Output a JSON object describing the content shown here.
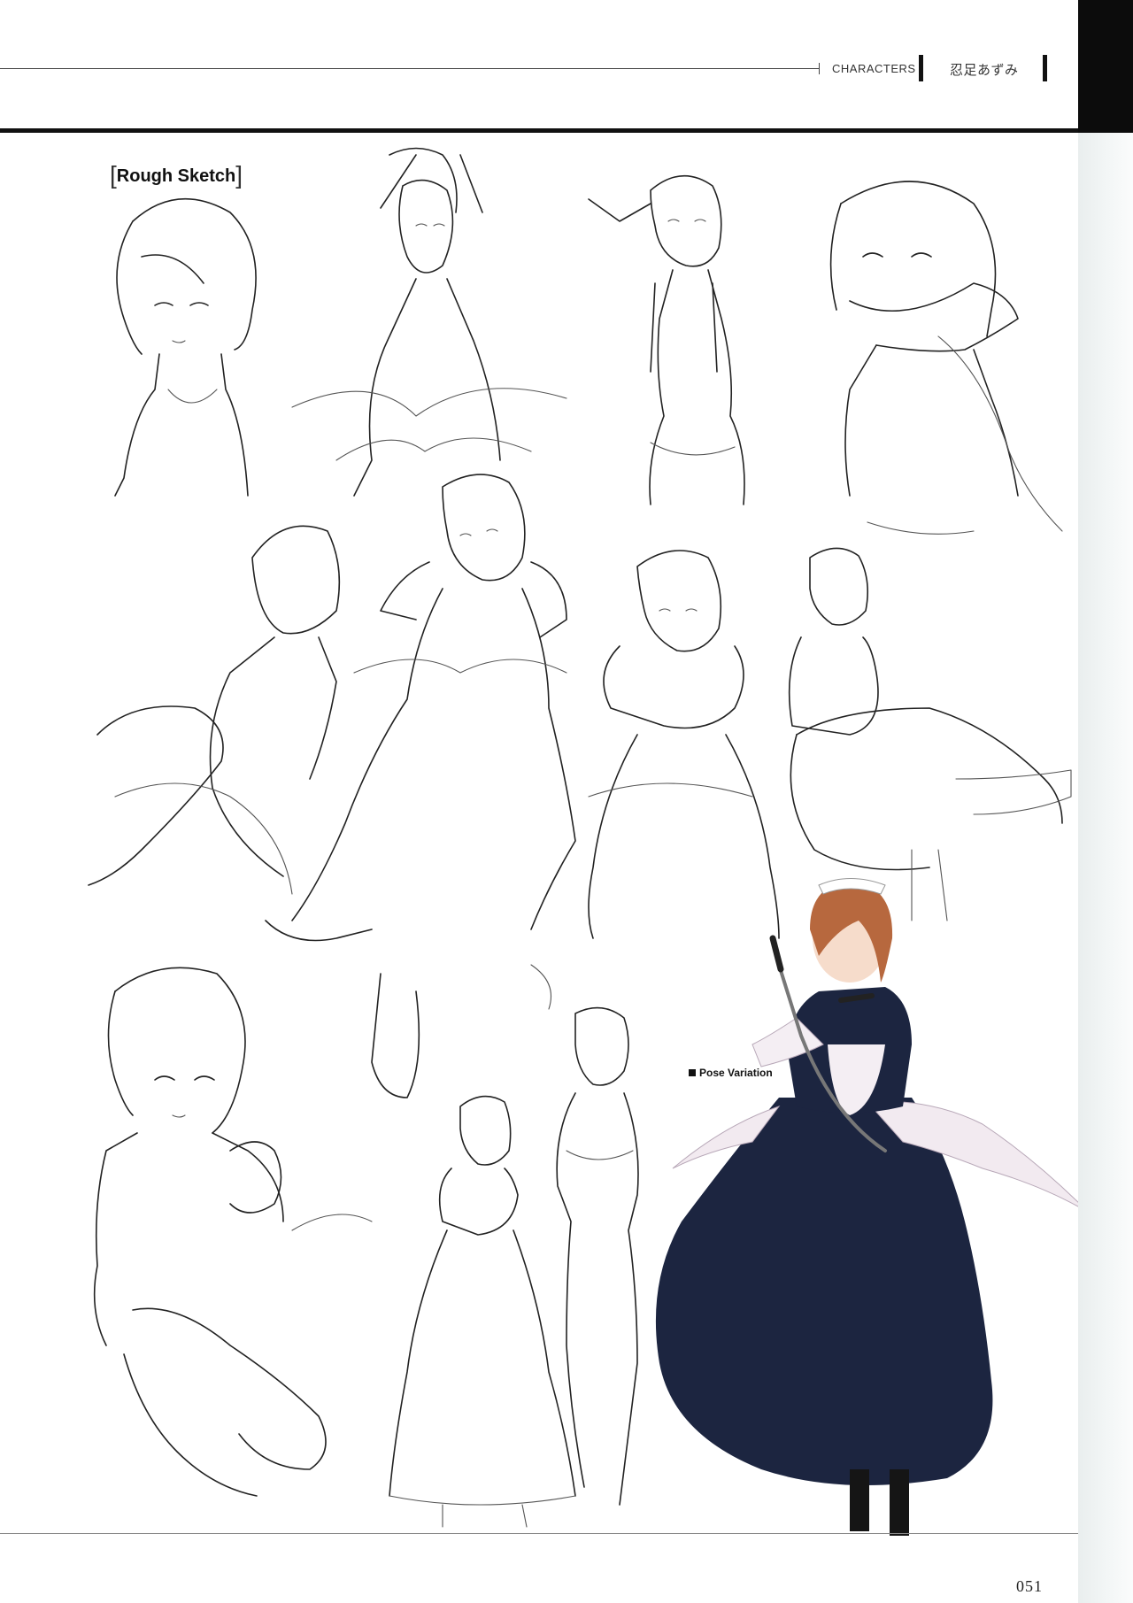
{
  "header": {
    "section": "CHARACTERS",
    "character_name": "忍足あずみ"
  },
  "sketch_section": {
    "title": "Rough Sketch"
  },
  "pose_section": {
    "title": "Pose Variation"
  },
  "footer": {
    "page_number": "051"
  },
  "colors": {
    "rule": "#111111",
    "side_strip": "#eef2f2",
    "dress": "#1c2540",
    "apron": "#f2eaf0",
    "hair": "#b7683e"
  }
}
